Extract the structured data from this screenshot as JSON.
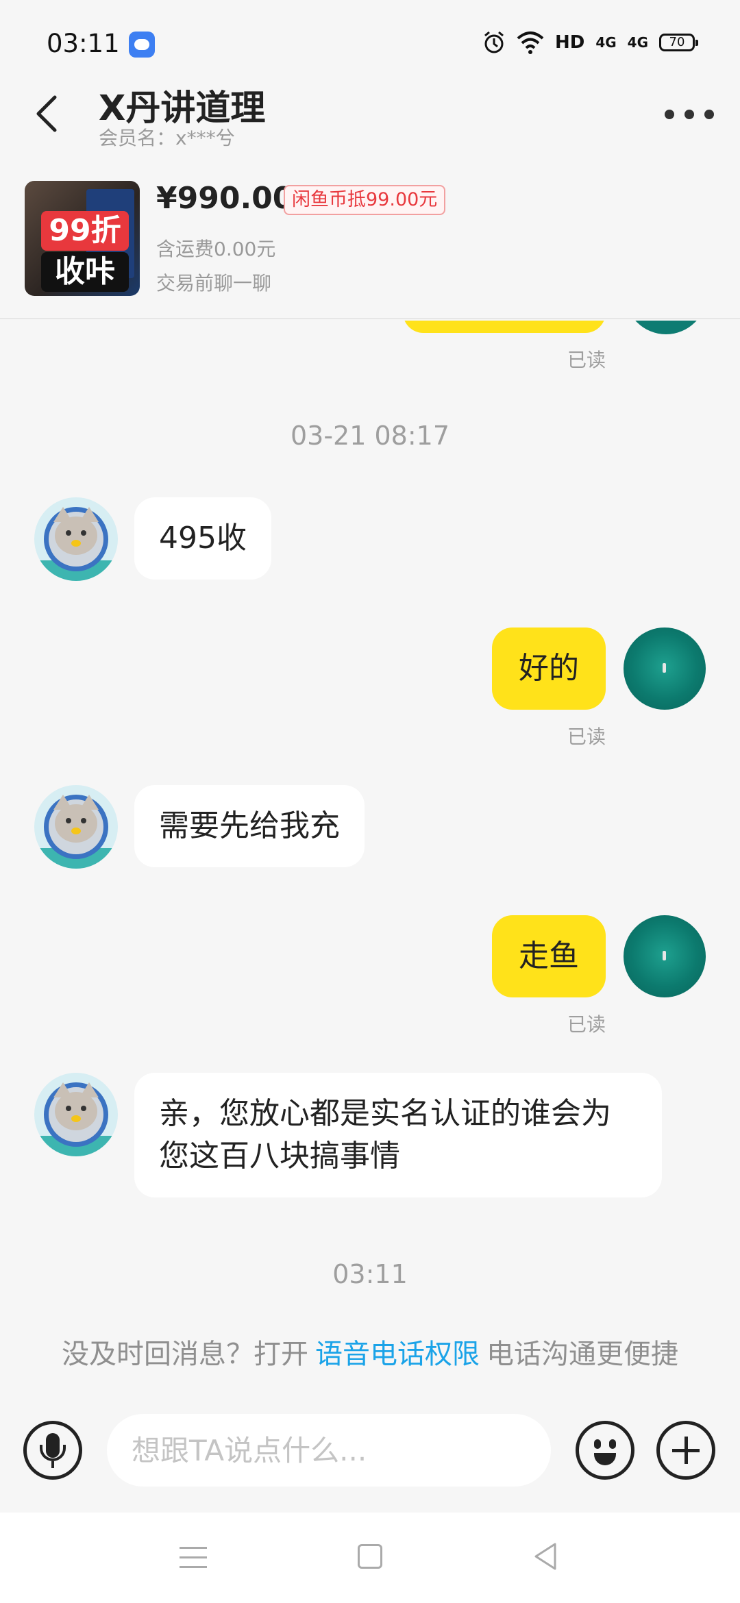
{
  "status_bar": {
    "time": "03:11",
    "network": "HD",
    "signal1": "4G",
    "signal2": "4G",
    "battery": "70"
  },
  "header": {
    "title": "X丹讲道理",
    "subtitle": "会员名：x***兮"
  },
  "product": {
    "thumb_top": "99折",
    "thumb_bottom": "收咔",
    "price": "¥990.00",
    "coin_badge": "闲鱼币抵99.00元",
    "shipping": "含运费0.00元",
    "note": "交易前聊一聊"
  },
  "chat": {
    "read_label": "已读",
    "timestamp1": "03-21 08:17",
    "timestamp2": "03:11",
    "messages": [
      {
        "from": "other",
        "text": "495收"
      },
      {
        "from": "me",
        "text": "好的"
      },
      {
        "from": "other",
        "text": "需要先给我充"
      },
      {
        "from": "me",
        "text": "走鱼"
      },
      {
        "from": "other",
        "text": "亲，您放心都是实名认证的谁会为您这百八块搞事情"
      }
    ]
  },
  "voice_tip": {
    "prefix": "没及时回消息？打开",
    "link": "语音电话权限",
    "suffix": "电话沟通更便捷"
  },
  "input": {
    "placeholder": "想跟TA说点什么..."
  },
  "colors": {
    "accent_yellow": "#ffe21a",
    "link_blue": "#1aa3e8",
    "badge_red": "#e8393e"
  },
  "icons": [
    "back-icon",
    "more-icon",
    "mic-icon",
    "emoji-icon",
    "plus-icon",
    "nav-menu-icon",
    "nav-home-icon",
    "nav-back-icon"
  ]
}
